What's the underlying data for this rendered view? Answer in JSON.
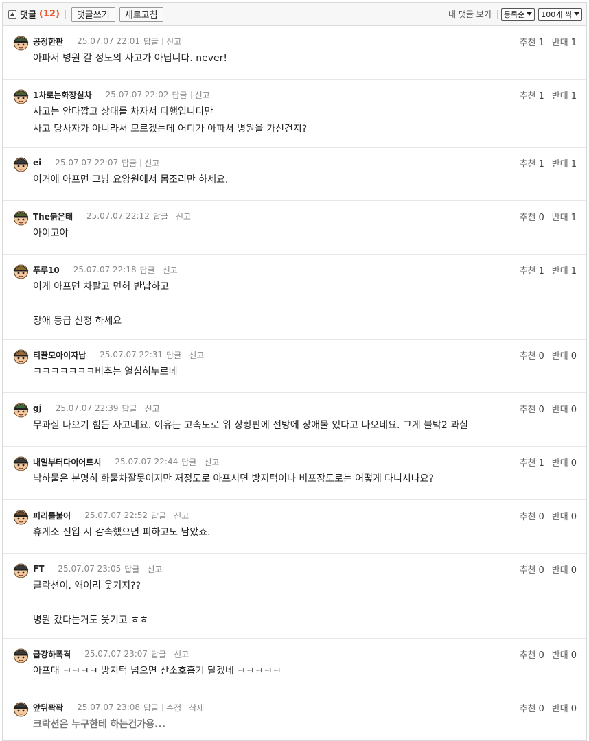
{
  "header": {
    "title": "댓글",
    "count": "(12)",
    "write_label": "댓글쓰기",
    "refresh_label": "새로고침",
    "my_comments_label": "내 댓글 보기",
    "sort_selected": "등록순",
    "per_page_selected": "100개 씩"
  },
  "labels": {
    "reply": "답글",
    "report": "신고",
    "edit": "수정",
    "delete": "삭제",
    "recommend": "추천",
    "oppose": "반대"
  },
  "comments": [
    {
      "nick": "공정한판",
      "date": "25.07.07 22:01",
      "rec": "1",
      "opp": "1",
      "lines": [
        "아파서 병원 갈 정도의 사고가 아닙니다. never!"
      ],
      "avatar": {
        "helmet": "#3c5a3c",
        "skin": "#f3c9a0"
      }
    },
    {
      "nick": "1차로는화장실차",
      "date": "25.07.07 22:02",
      "rec": "1",
      "opp": "1",
      "lines": [
        "사고는 안타깝고 상대를 차자서 다행입니다만",
        "사고 당사자가 아니라서 모르겠는데 어디가 아파서 병원을 가신건지?"
      ],
      "avatar": {
        "helmet": "#4a5e2e",
        "skin": "#f3c9a0"
      }
    },
    {
      "nick": "ei",
      "date": "25.07.07 22:07",
      "rec": "1",
      "opp": "1",
      "lines": [
        "이거에 아프면 그냥 요양원에서 몸조리만 하세요."
      ],
      "avatar": {
        "helmet": "#3a3a3a",
        "skin": "#f3c9a0"
      }
    },
    {
      "nick": "The붉은태",
      "date": "25.07.07 22:12",
      "rec": "0",
      "opp": "1",
      "lines": [
        "아이고야"
      ],
      "avatar": {
        "helmet": "#4a5e2e",
        "skin": "#f3c9a0"
      }
    },
    {
      "nick": "푸루10",
      "date": "25.07.07 22:18",
      "rec": "1",
      "opp": "1",
      "lines": [
        "이게 아프면 차팔고 면허 반납하고",
        "",
        "장애 등급 신청 하세요"
      ],
      "avatar": {
        "helmet": "#8a6a2a",
        "skin": "#f3c9a0"
      }
    },
    {
      "nick": "티끌모아이자납",
      "date": "25.07.07 22:31",
      "rec": "0",
      "opp": "0",
      "lines": [
        "ㅋㅋㅋㅋㅋㅋㅋ비추는 열심히누르네"
      ],
      "avatar": {
        "helmet": "#9a6a3a",
        "skin": "#f3c9a0"
      }
    },
    {
      "nick": "gj",
      "date": "25.07.07 22:39",
      "rec": "0",
      "opp": "0",
      "lines": [
        "무과실 나오기 힘든 사고네요. 이유는 고속도로 위 상황판에 전방에 장애물 있다고 나오네요. 그게 블박2 과실"
      ],
      "avatar": {
        "helmet": "#3c6a3c",
        "skin": "#f3c9a0"
      }
    },
    {
      "nick": "내일부터다이어트시",
      "date": "25.07.07 22:44",
      "rec": "1",
      "opp": "0",
      "lines": [
        "낙하물은 분명히 화물차잘못이지만 저정도로 아프시면 방지턱이나 비포장도로는 어떻게 다니시나요?"
      ],
      "avatar": {
        "helmet": "#3a3a3a",
        "skin": "#f3c9a0"
      }
    },
    {
      "nick": "피리를불어",
      "date": "25.07.07 22:52",
      "rec": "0",
      "opp": "0",
      "lines": [
        "휴게소 진입 시 감속했으면 피하고도 남았죠."
      ],
      "avatar": {
        "helmet": "#6a4a2a",
        "skin": "#f3c9a0"
      }
    },
    {
      "nick": "FT",
      "date": "25.07.07 23:05",
      "rec": "0",
      "opp": "0",
      "lines": [
        "클락션이. 왜이리 웃기지??",
        "",
        "병원 갔다는거도 웃기고 ㅎㅎ"
      ],
      "avatar": {
        "helmet": "#3a3a3a",
        "skin": "#f3c9a0"
      }
    },
    {
      "nick": "급강하폭격",
      "date": "25.07.07 23:07",
      "rec": "0",
      "opp": "0",
      "lines": [
        "아프대 ㅋㅋㅋㅋ 방지턱 넘으면 산소호흡기 달겠네 ㅋㅋㅋㅋㅋ"
      ],
      "avatar": {
        "helmet": "#3a3a3a",
        "skin": "#f3c9a0"
      }
    },
    {
      "nick": "앞뒤꽉꽉",
      "date": "25.07.07 23:08",
      "rec": "0",
      "opp": "0",
      "lines": [
        "크락션은 누구한테 하는건가용..."
      ],
      "avatar": {
        "helmet": "#3a3a3a",
        "skin": "#f3c9a0"
      },
      "own": true
    }
  ]
}
